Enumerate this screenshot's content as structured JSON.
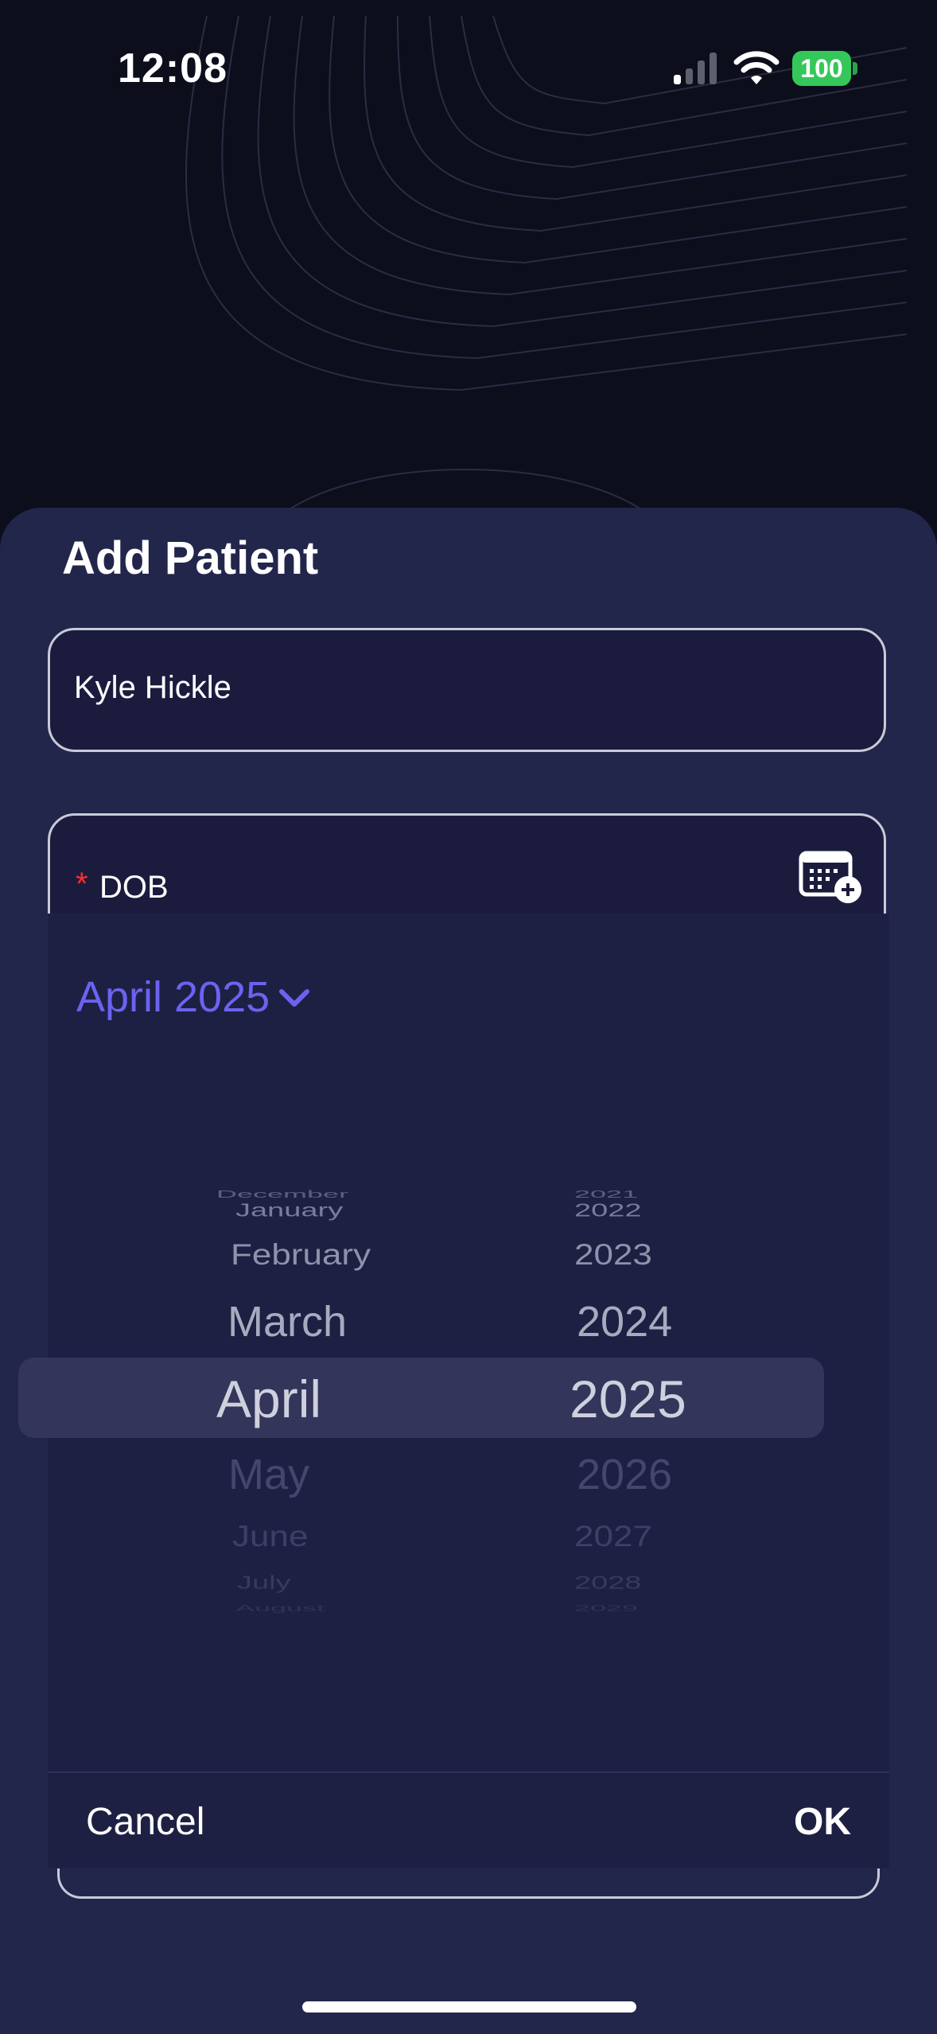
{
  "status_bar": {
    "time": "12:08",
    "battery": "100",
    "signal_icon": "cellular-signal-icon",
    "wifi_icon": "wifi-icon"
  },
  "sheet": {
    "title": "Add Patient",
    "name_field": {
      "value": "Kyle Hickle"
    },
    "dob_field": {
      "required_marker": "*",
      "label": "DOB",
      "icon": "calendar-add-icon"
    }
  },
  "date_picker": {
    "header": "April 2025",
    "header_icon": "chevron-down-icon",
    "month_wheel": [
      "December",
      "January",
      "February",
      "March",
      "April",
      "May",
      "June",
      "July",
      "August"
    ],
    "year_wheel": [
      "2021",
      "2022",
      "2023",
      "2024",
      "2025",
      "2026",
      "2027",
      "2028",
      "2029"
    ],
    "selected_month": "April",
    "selected_year": "2025",
    "cancel_label": "Cancel",
    "ok_label": "OK"
  },
  "colors": {
    "accent": "#6b63f0",
    "sheet": "#23264b",
    "picker": "#1e2043",
    "required": "#ff2d2d",
    "battery": "#34c759"
  }
}
